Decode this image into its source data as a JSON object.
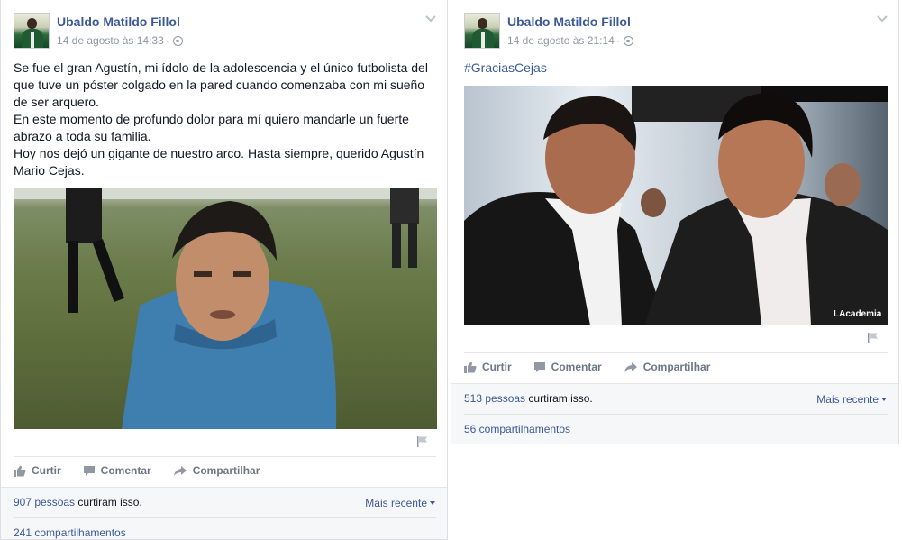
{
  "posts": [
    {
      "author": "Ubaldo Matildo Fillol",
      "timestamp": "14 de agosto às 14:33",
      "paragraphs": [
        "Se fue el gran Agustín, mi ídolo de la adolescencia y el único futbolista del que tuve un póster colgado en la pared cuando comenzaba con mi sueño de ser arquero.",
        "En este momento de profundo dolor para mí quiero mandarle un fuerte abrazo a toda su familia.",
        "Hoy nos dejó un gigante de nuestro arco. Hasta siempre, querido Agustín Mario Cejas."
      ],
      "actions": {
        "like": "Curtir",
        "comment": "Comentar",
        "share": "Compartilhar"
      },
      "likes_link": "907 pessoas",
      "likes_suffix": " curtiram isso.",
      "sort": "Mais recente",
      "shares": "241 compartilhamentos"
    },
    {
      "author": "Ubaldo Matildo Fillol",
      "timestamp": "14 de agosto às 21:14",
      "hashtag": "#GraciasCejas",
      "watermark": "LAcademia",
      "actions": {
        "like": "Curtir",
        "comment": "Comentar",
        "share": "Compartilhar"
      },
      "likes_link": "513 pessoas",
      "likes_suffix": " curtiram isso.",
      "sort": "Mais recente",
      "shares": "56 compartilhamentos"
    }
  ],
  "icons": {
    "privacy": "globe-icon",
    "menu": "chevron-down-icon",
    "report": "flag-icon",
    "like": "thumbs-up-icon",
    "comment": "comment-bubble-icon",
    "share": "share-arrow-icon"
  },
  "colors": {
    "link": "#3b5998",
    "action_text": "#6e7784",
    "meta": "#9197a3",
    "ufi_bg": "#f6f7f8"
  }
}
